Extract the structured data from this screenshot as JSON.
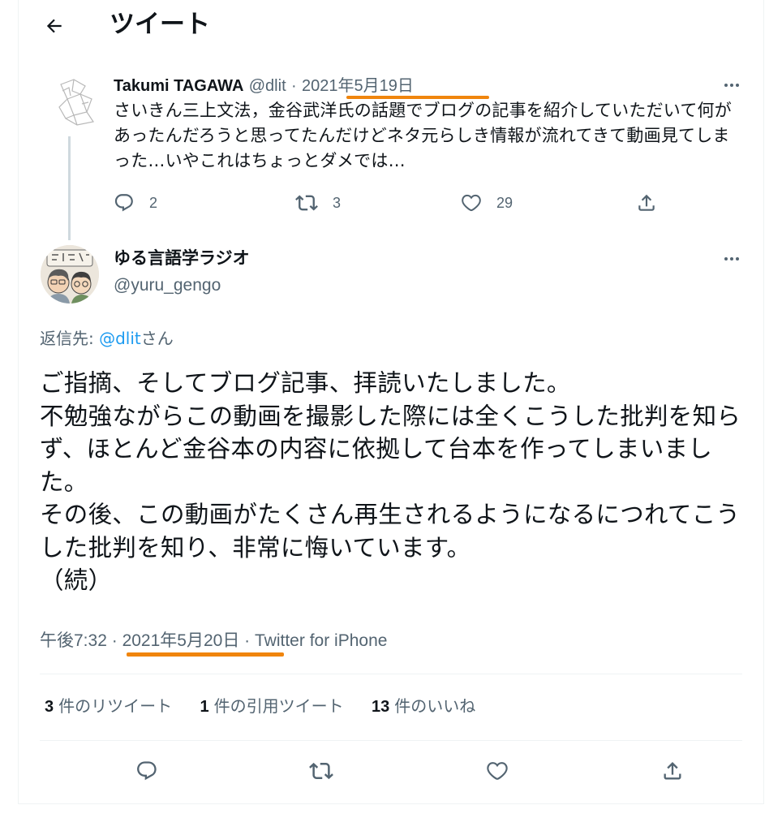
{
  "header": {
    "title": "ツイート"
  },
  "parent_tweet": {
    "name": "Takumi TAGAWA",
    "handle": "@dlit",
    "dot": "·",
    "date": "2021年5月19日",
    "text": "さいきん三上文法，金谷武洋氏の話題でブログの記事を紹介していただいて何があったんだろうと思ってたんだけどネタ元らしき情報が流れてきて動画見てしまった…いやこれはちょっとダメでは…",
    "replies": "2",
    "retweets": "3",
    "likes": "29"
  },
  "main_tweet": {
    "name": "ゆる言語学ラジオ",
    "handle": "@yuru_gengo",
    "reply_prefix": "返信先: ",
    "reply_mention": "@dlit",
    "reply_suffix": "さん",
    "text": "ご指摘、そしてブログ記事、拝読いたしました。\n不勉強ながらこの動画を撮影した際には全くこうした批判を知らず、ほとんど金谷本の内容に依拠して台本を作ってしまいました。\nその後、この動画がたくさん再生されるようになるにつれてこうした批判を知り、非常に悔いています。\n（続）",
    "time": "午後7:32",
    "dot": "·",
    "date": "2021年5月20日",
    "source": "Twitter for iPhone",
    "retweets_count": "3",
    "retweets_label": "件のリツイート",
    "quotes_count": "1",
    "quotes_label": "件の引用ツイート",
    "likes_count": "13",
    "likes_label": "件のいいね"
  },
  "colors": {
    "highlight": "#f0850d",
    "link": "#1d9bf0",
    "secondary_text": "#536471"
  },
  "icons": [
    "back-arrow-icon",
    "more-icon",
    "reply-icon",
    "retweet-icon",
    "like-icon",
    "share-icon"
  ]
}
